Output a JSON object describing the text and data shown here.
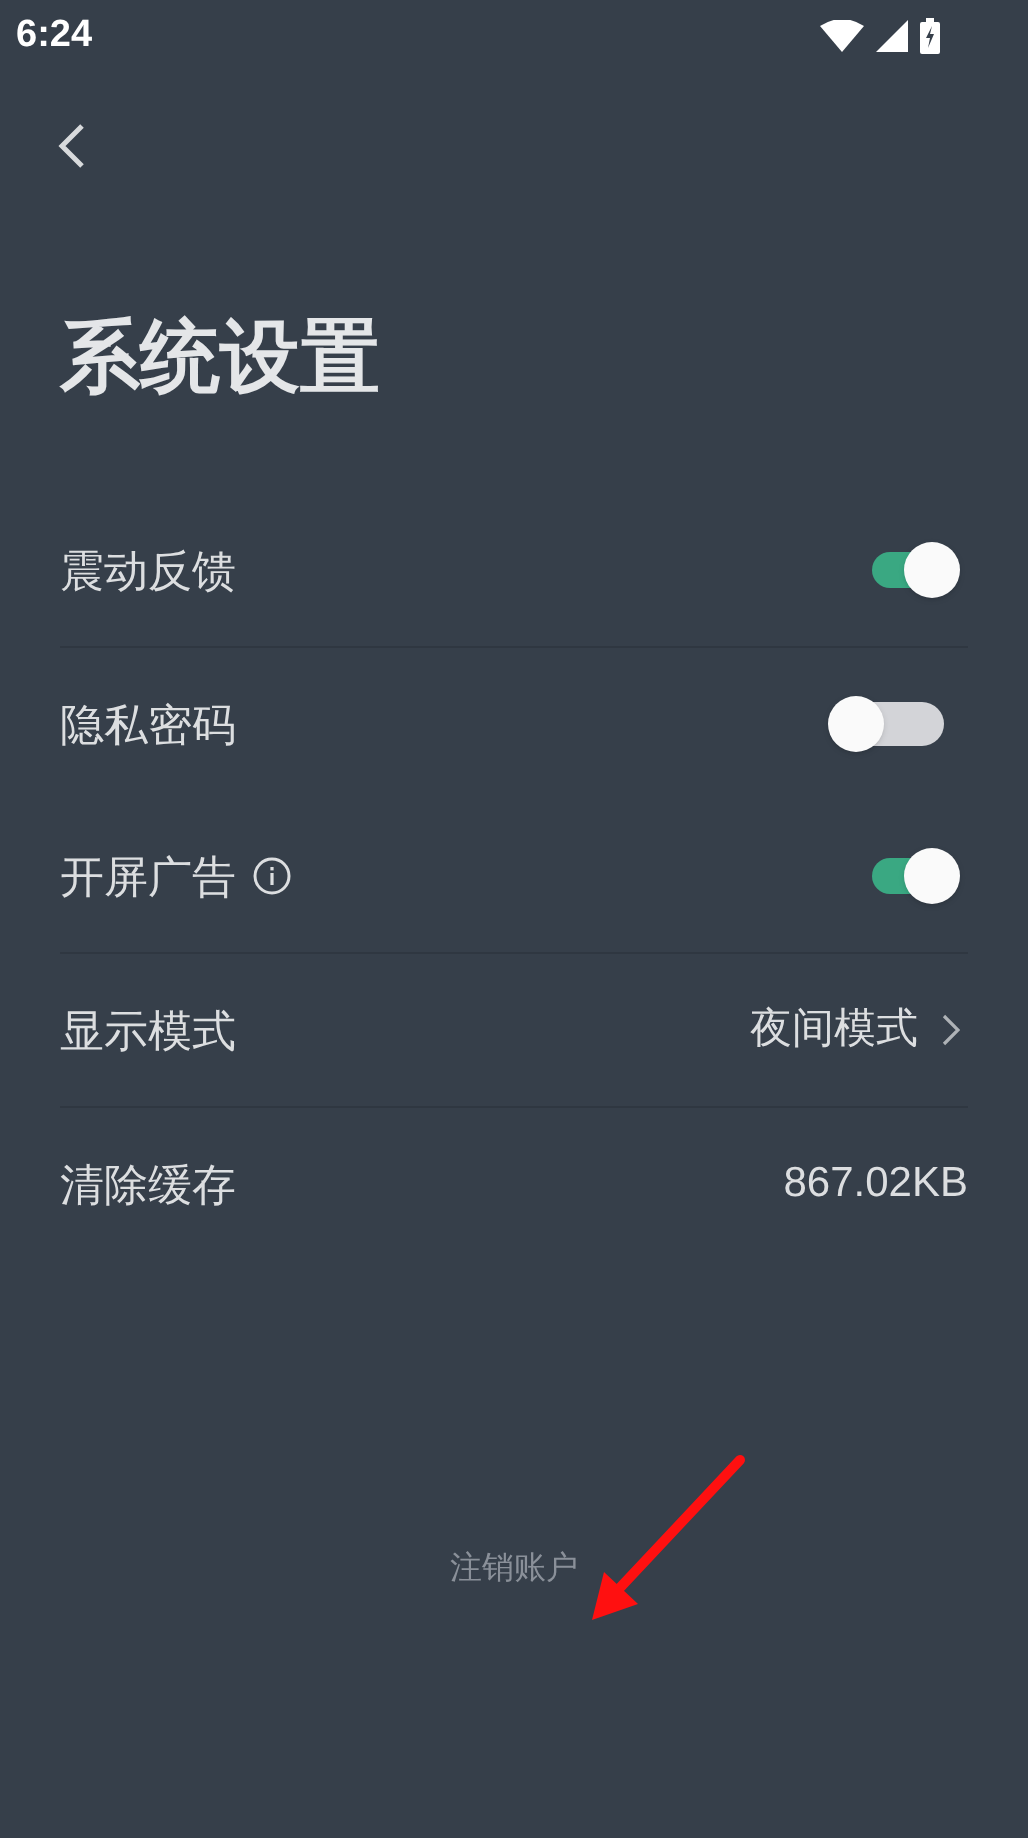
{
  "status_bar": {
    "time": "6:24"
  },
  "title": "系统设置",
  "rows": [
    {
      "kind": "toggle",
      "label": "震动反馈",
      "on": true,
      "divider_below": true
    },
    {
      "kind": "toggle",
      "label": "隐私密码",
      "on": false,
      "divider_below": false
    },
    {
      "kind": "toggle",
      "label": "开屏广告",
      "on": true,
      "info": true,
      "divider_below": true
    },
    {
      "kind": "link",
      "label": "显示模式",
      "value": "夜间模式",
      "divider_below": true
    },
    {
      "kind": "value",
      "label": "清除缓存",
      "value": "867.02KB",
      "divider_below": false
    }
  ],
  "footer_link": "注销账户"
}
